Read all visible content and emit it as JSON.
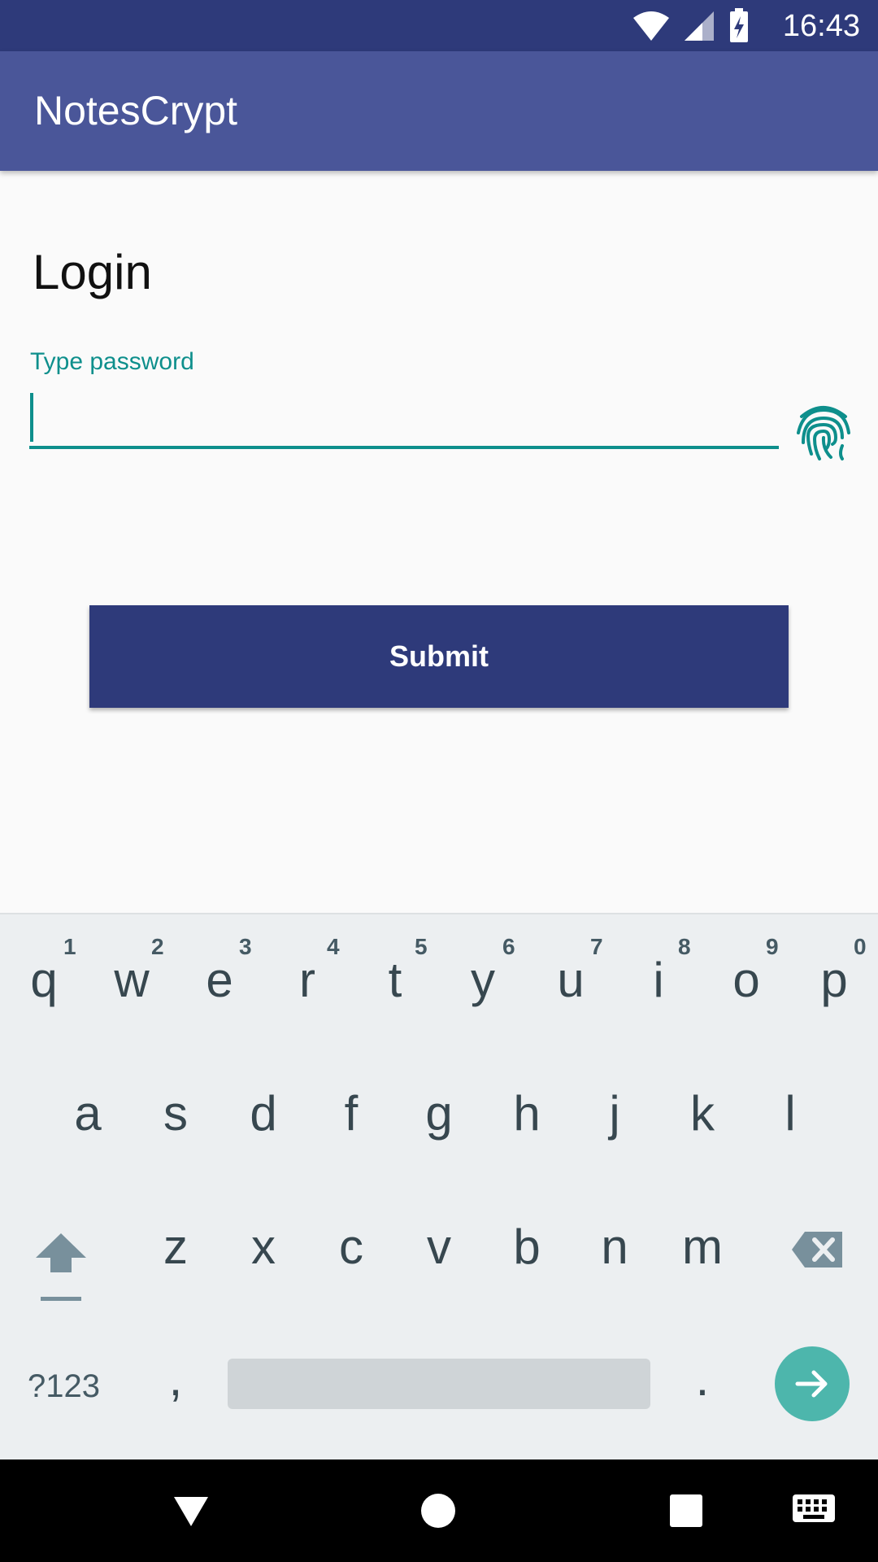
{
  "status": {
    "time": "16:43"
  },
  "app": {
    "title": "NotesCrypt"
  },
  "page": {
    "title": "Login",
    "password_label": "Type password",
    "password_value": "",
    "submit_label": "Submit"
  },
  "keyboard": {
    "row1": [
      "q",
      "w",
      "e",
      "r",
      "t",
      "y",
      "u",
      "i",
      "o",
      "p"
    ],
    "row1_hints": [
      "1",
      "2",
      "3",
      "4",
      "5",
      "6",
      "7",
      "8",
      "9",
      "0"
    ],
    "row2": [
      "a",
      "s",
      "d",
      "f",
      "g",
      "h",
      "j",
      "k",
      "l"
    ],
    "row3": [
      "z",
      "x",
      "c",
      "v",
      "b",
      "n",
      "m"
    ],
    "symbols_label": "?123",
    "comma": ",",
    "period": ".",
    "enter_color": "#4db6ac"
  },
  "colors": {
    "primary": "#2e3a7a",
    "appbar": "#4a5699",
    "accent": "#0e8f8c"
  },
  "icons": [
    "wifi-icon",
    "signal-icon",
    "battery-charging-icon",
    "fingerprint-icon",
    "shift-icon",
    "backspace-icon",
    "enter-arrow-icon",
    "back-icon",
    "home-icon",
    "recents-icon",
    "keyboard-icon"
  ]
}
